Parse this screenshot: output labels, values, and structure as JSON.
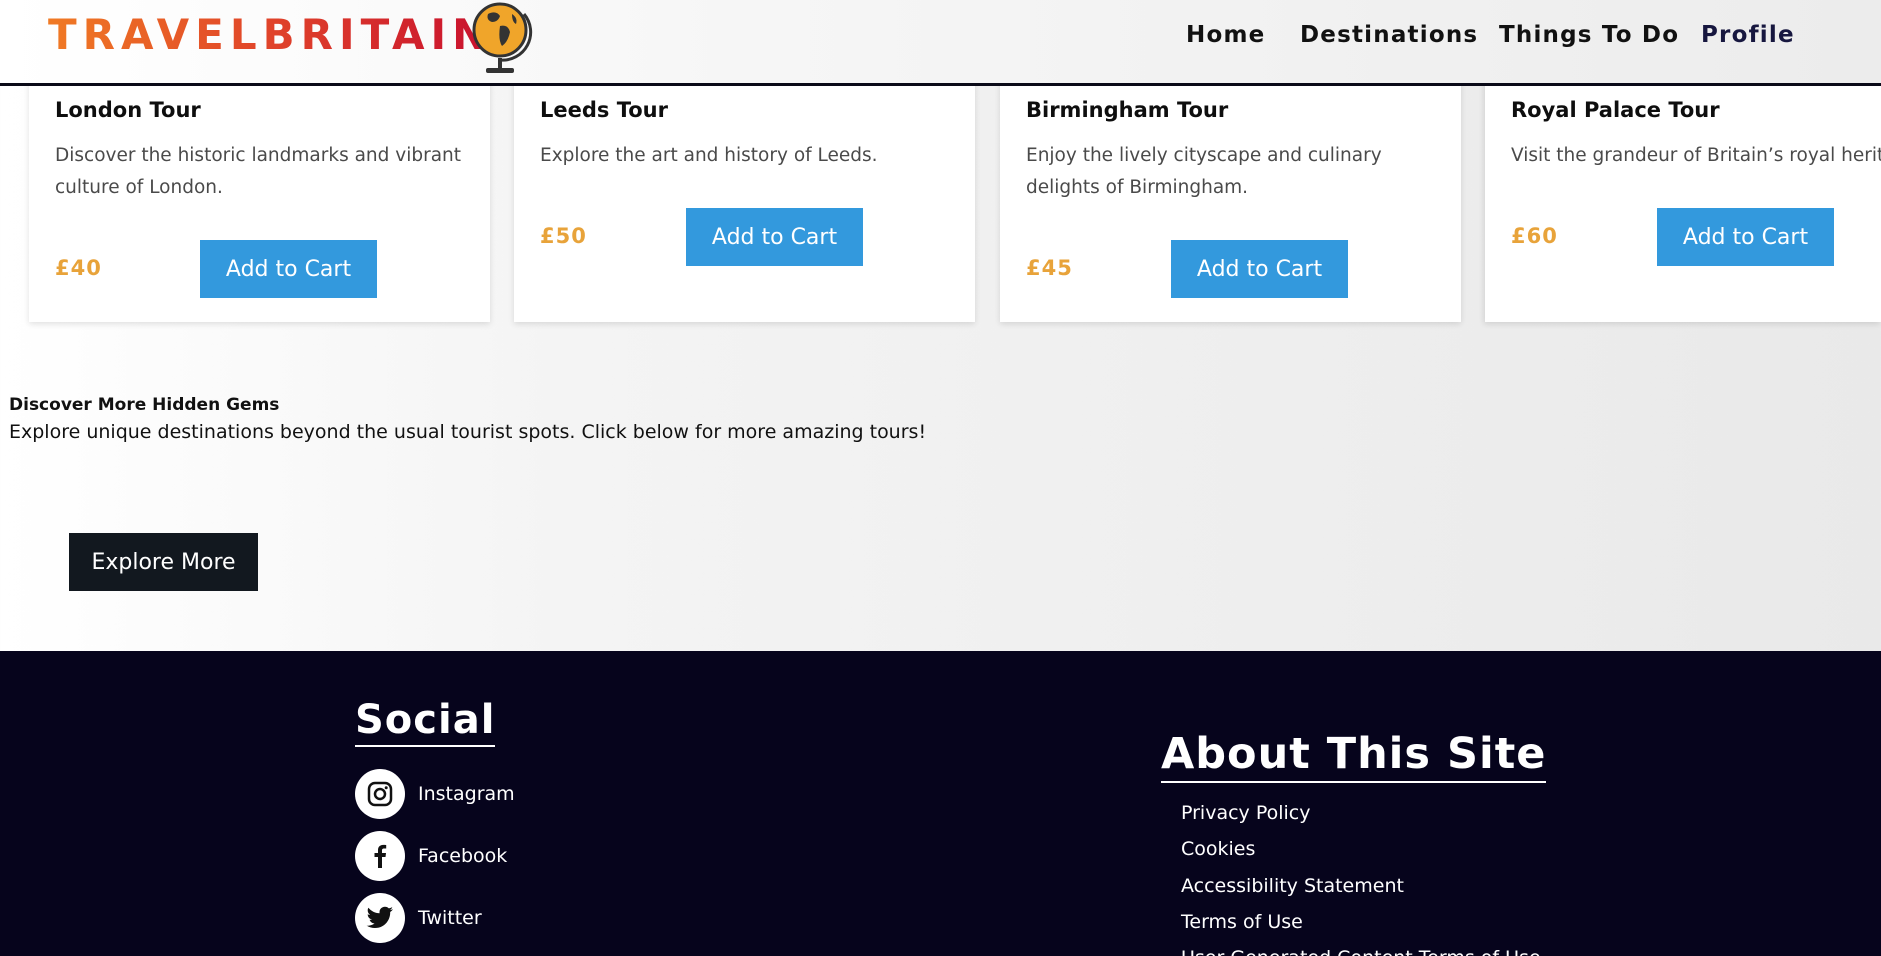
{
  "header": {
    "logo": "TRAVELBRITAIN",
    "nav": [
      {
        "label": "Home",
        "active": false
      },
      {
        "label": "Destinations",
        "active": false
      },
      {
        "label": "Things To Do",
        "active": false
      },
      {
        "label": "Profile",
        "active": true
      }
    ]
  },
  "tours": [
    {
      "title": "London Tour",
      "description": "Discover the historic landmarks and vibrant culture of London.",
      "price": "£40",
      "button": "Add to Cart"
    },
    {
      "title": "Leeds Tour",
      "description": "Explore the art and history of Leeds.",
      "price": "£50",
      "button": "Add to Cart"
    },
    {
      "title": "Birmingham Tour",
      "description": "Enjoy the lively cityscape and culinary delights of Birmingham.",
      "price": "£45",
      "button": "Add to Cart"
    },
    {
      "title": "Royal Palace Tour",
      "description": "Visit the grandeur of Britain’s royal herita",
      "price": "£60",
      "button": "Add to Cart"
    }
  ],
  "hidden_gems": {
    "title": "Discover More Hidden Gems",
    "text": "Explore unique destinations beyond the usual tourist spots. Click below for more amazing tours!",
    "button": "Explore More"
  },
  "footer": {
    "social": {
      "heading": "Social",
      "items": [
        {
          "label": "Instagram",
          "icon": "instagram-icon"
        },
        {
          "label": "Facebook",
          "icon": "facebook-icon"
        },
        {
          "label": "Twitter",
          "icon": "twitter-icon"
        }
      ]
    },
    "about": {
      "heading": "About This Site",
      "links": [
        "Privacy Policy",
        "Cookies",
        "Accessibility Statement",
        "Terms of Use",
        "User Generated Content Terms of Use"
      ]
    }
  },
  "colors": {
    "primary_button": "#3399dd",
    "price": "#e8a33a",
    "footer_bg": "#06041c",
    "explore_button": "#12181f"
  }
}
